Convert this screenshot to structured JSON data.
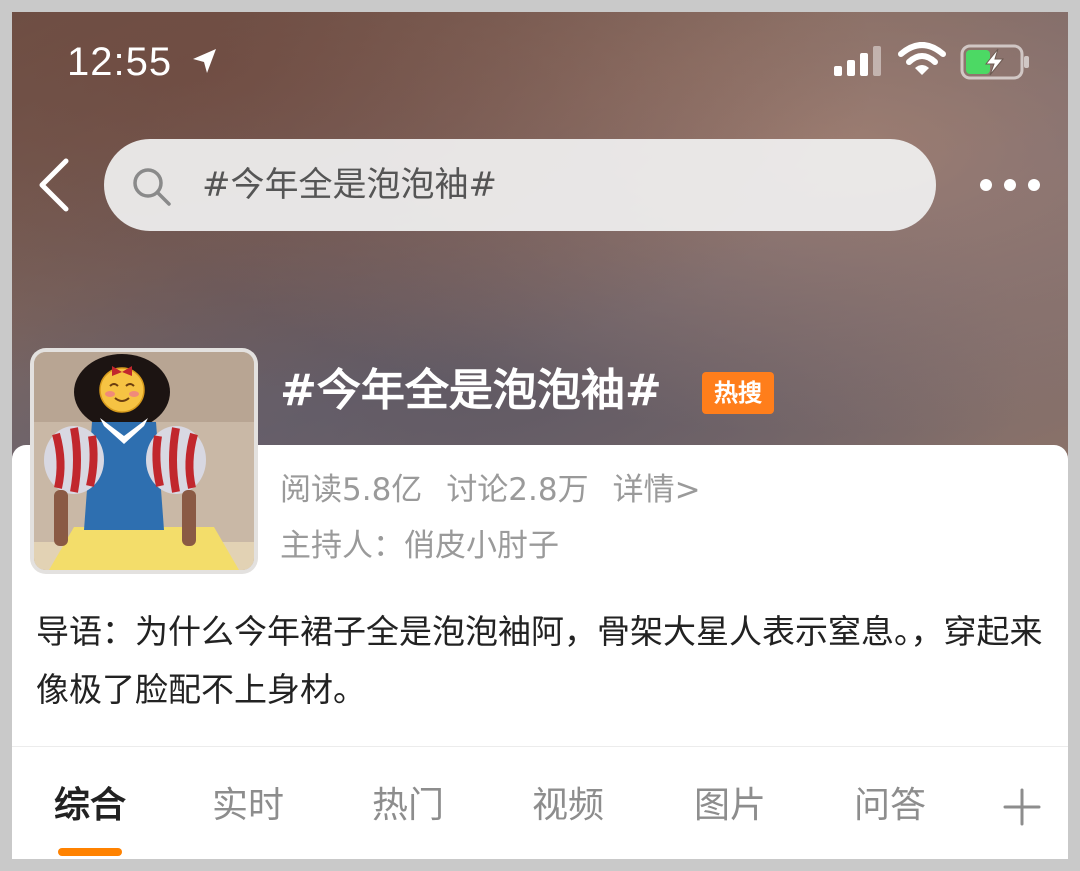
{
  "status_bar": {
    "time": "12:55",
    "location_icon": "location-arrow-icon",
    "signal_icon": "cellular-signal-icon",
    "wifi_icon": "wifi-icon",
    "battery_icon": "battery-charging-icon"
  },
  "nav": {
    "back_icon": "chevron-left-icon",
    "search_icon": "search-icon",
    "search_query": "#今年全是泡泡袖#",
    "more_icon": "more-dots-icon"
  },
  "topic": {
    "title": "#今年全是泡泡袖#",
    "badge": "热搜",
    "reads": "阅读5.8亿",
    "discussions": "讨论2.8万",
    "details_link": "详情>",
    "host": "主持人：俏皮小肘子",
    "intro": "导语：为什么今年裙子全是泡泡袖阿，骨架大星人表示窒息。，穿起来像极了脸配不上身材。"
  },
  "tabs": {
    "items": [
      {
        "label": "综合",
        "active": true
      },
      {
        "label": "实时",
        "active": false
      },
      {
        "label": "热门",
        "active": false
      },
      {
        "label": "视频",
        "active": false
      },
      {
        "label": "图片",
        "active": false
      },
      {
        "label": "问答",
        "active": false
      }
    ],
    "add_icon": "plus-icon"
  },
  "colors": {
    "accent_orange": "#ff8200",
    "badge_orange": "#ff7e1b",
    "muted_text": "#9a9a9a",
    "body_text": "#222222"
  }
}
